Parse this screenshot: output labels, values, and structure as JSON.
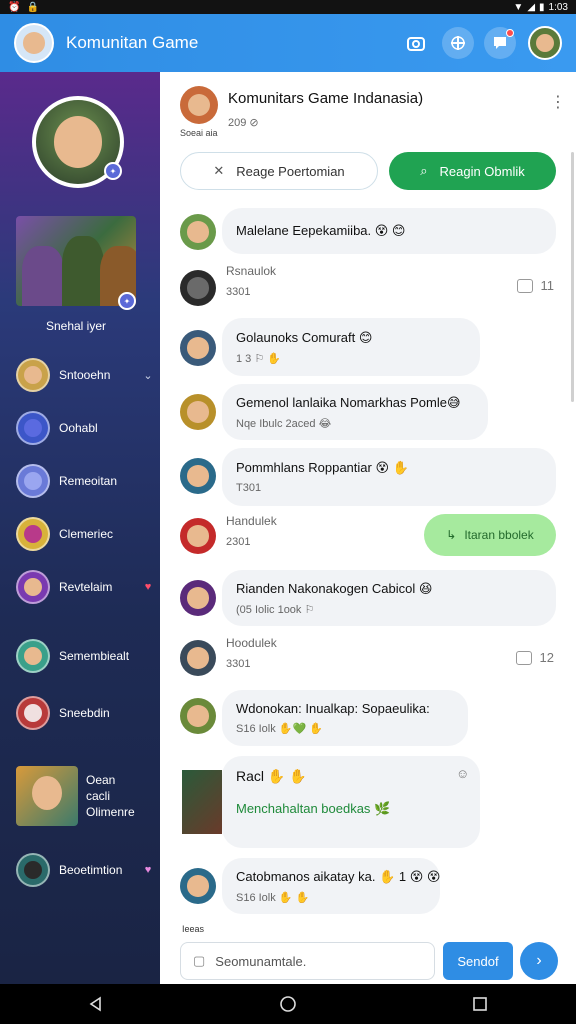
{
  "status_bar": {
    "left_icons": [
      "alarm-icon",
      "lock-icon"
    ],
    "time": "1:03"
  },
  "app_bar": {
    "title": "Komunitan Game",
    "accent": "#2f8de4",
    "actions": [
      "camera-icon",
      "grid-icon",
      "chat-notification-icon"
    ]
  },
  "sidebar": {
    "banner_label": "Snehal iyer",
    "items": [
      {
        "label": "Sntooehn",
        "trail": "⌄",
        "color": "#c9a24a"
      },
      {
        "label": "Oohabl",
        "trail": "",
        "color": "#3c56c8"
      },
      {
        "label": "Remeoitan",
        "trail": "",
        "color": "#6a7ad8"
      },
      {
        "label": "Clemeriec",
        "trail": "",
        "color": "#d8b23a"
      },
      {
        "label": "Revtelaim",
        "trail": "♥",
        "color": "#7a3ab0"
      },
      {
        "label": "Semembiealt",
        "trail": "",
        "color": "#3aa08a"
      },
      {
        "label": "Sneebdin",
        "trail": "",
        "color": "#b83a3a"
      }
    ],
    "big_item": {
      "line1": "Oean",
      "line2": "cacli",
      "line3": "Olimenre"
    },
    "last_item": {
      "label": "Beoetimtion",
      "trail": "♥"
    }
  },
  "group": {
    "name": "Komunitars Game Indanasia)",
    "meta": "209 ⊘",
    "sub": "Soeai aia",
    "buttons": {
      "outline": "Reage Poertomian",
      "solid": "Reagin Obmlik"
    }
  },
  "messages": [
    {
      "text": "Malelane Eepekamiiba.",
      "emoji": "😵 😊"
    },
    {
      "label": "Rsnaulok",
      "sub": "3301",
      "count": "11"
    },
    {
      "text": "Golaunoks Comuraft",
      "emoji": "😊",
      "sub": "1 3 ⚐ ✋"
    },
    {
      "text": "Gemenol lanlaika Nomarkhas Pomle😅",
      "sub": "Nqe Ibulc 2aced 😂"
    },
    {
      "text": "Pommhlans Roppantiar",
      "emoji": "😵 ✋",
      "sub": "T301"
    },
    {
      "label": "Handulek",
      "sub": "2301",
      "reply": "Itaran bbolek"
    },
    {
      "text": "Rianden Nakonakogen Cabicol",
      "emoji": "😆",
      "sub": "(05 Iolic 1ook ⚐"
    },
    {
      "label": "Hoodulek",
      "sub": "3301",
      "count": "12"
    },
    {
      "text": "Wdonokan: Inualkap: Sopaeulika:",
      "sub": "S16 Iolk ✋💚 ✋"
    },
    {
      "title": "Racl",
      "emoji": "✋ ✋",
      "green_text": "Menchahaltan boedkas",
      "reaction": "🌿"
    },
    {
      "text": "Catobmanos aikatay ka. ✋ 1",
      "emoji": "😵 😵",
      "sub": "S16 Iolk ✋ ✋"
    }
  ],
  "composer": {
    "small_label": "Ieeas",
    "placeholder": "Seomunamtale.",
    "send": "Sendof"
  }
}
